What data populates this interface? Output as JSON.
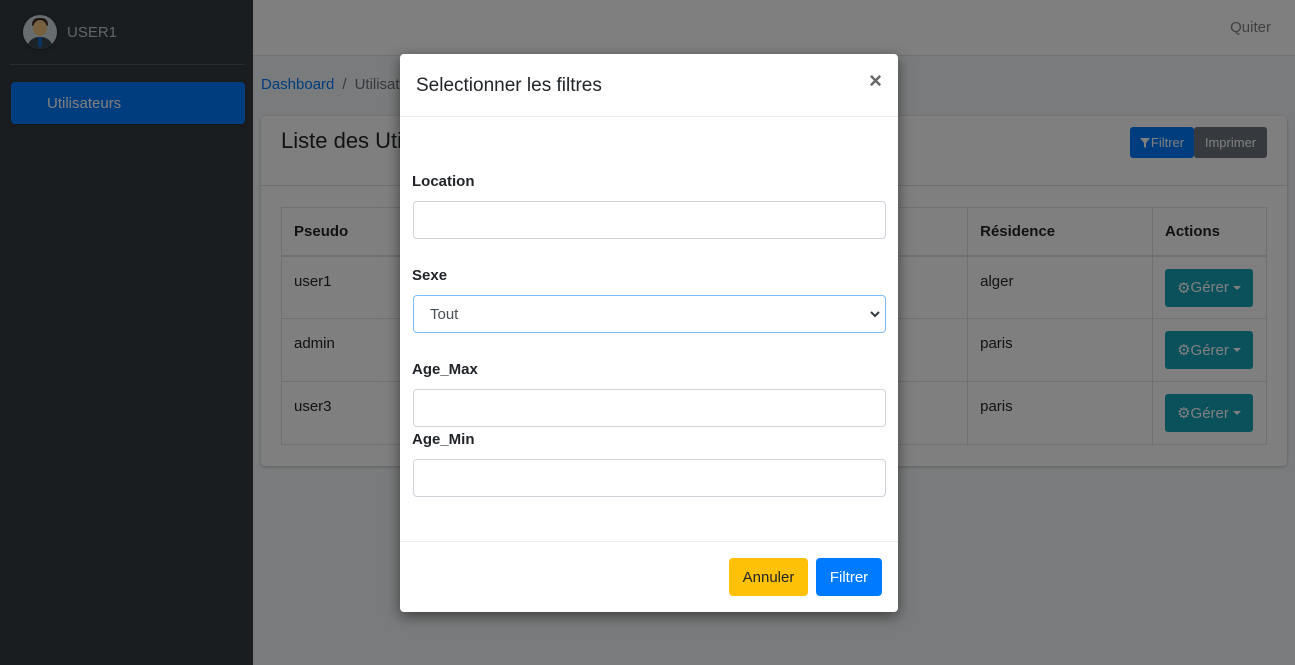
{
  "sidebar": {
    "user_name": "USER1",
    "items": [
      {
        "label": "Utilisateurs"
      }
    ]
  },
  "navbar": {
    "quit_label": "Quiter"
  },
  "breadcrumb": {
    "home": "Dashboard",
    "separator": "/",
    "current": "Utilisat"
  },
  "card": {
    "title": "Liste des Uti",
    "filter_button": "Filtrer",
    "print_button": "Imprimer"
  },
  "table": {
    "headers": [
      "Pseudo",
      "Résidence",
      "Actions"
    ],
    "rows": [
      {
        "pseudo": "user1",
        "residence": "alger",
        "action": "Gérer"
      },
      {
        "pseudo": "admin",
        "residence": "paris",
        "action": "Gérer"
      },
      {
        "pseudo": "user3",
        "residence": "paris",
        "action": "Gérer"
      }
    ]
  },
  "modal": {
    "title": "Selectionner les filtres",
    "close_symbol": "×",
    "location_label": "Location",
    "location_value": "",
    "sexe_label": "Sexe",
    "sexe_selected": "Tout",
    "age_max_label": "Age_Max",
    "age_max_value": "",
    "age_min_label": "Age_Min",
    "age_min_value": "",
    "cancel_button": "Annuler",
    "submit_button": "Filtrer"
  },
  "colors": {
    "primary": "#007bff",
    "warning": "#ffc107",
    "info": "#17a2b8",
    "secondary": "#6c757d",
    "sidebar": "#343a40"
  }
}
